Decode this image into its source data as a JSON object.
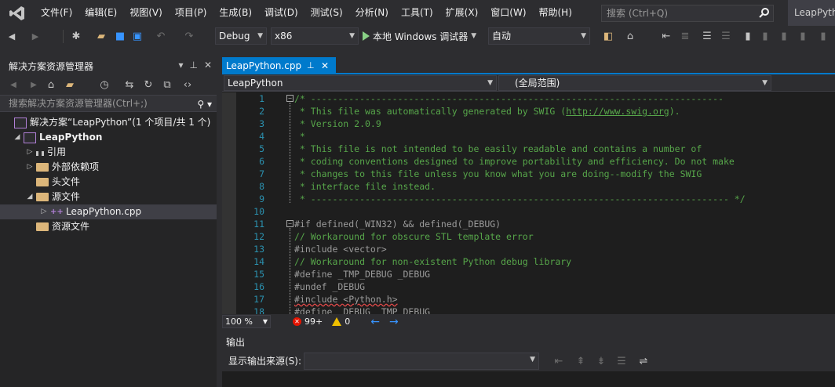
{
  "menu": {
    "items": [
      "文件(F)",
      "编辑(E)",
      "视图(V)",
      "项目(P)",
      "生成(B)",
      "调试(D)",
      "测试(S)",
      "分析(N)",
      "工具(T)",
      "扩展(X)",
      "窗口(W)",
      "帮助(H)"
    ],
    "search_placeholder": "搜索 (Ctrl+Q)",
    "title": "LeapPython"
  },
  "toolbar": {
    "config": "Debug",
    "platform": "x86",
    "run_label": "本地 Windows 调试器",
    "run_mode": "自动"
  },
  "solution_explorer": {
    "title": "解决方案资源管理器",
    "search_placeholder": "搜索解决方案资源管理器(Ctrl+;)",
    "tree": {
      "solution": "解决方案“LeapPython”(1 个项目/共 1 个)",
      "project": "LeapPython",
      "references": "引用",
      "external_deps": "外部依赖项",
      "headers": "头文件",
      "sources": "源文件",
      "source_file": "LeapPython.cpp",
      "resources": "资源文件"
    }
  },
  "editor": {
    "tab_label": "LeapPython.cpp",
    "tab_pin": "ㅁ",
    "tab_close": "✕",
    "nav_project": "LeapPython",
    "nav_scope": "(全局范围)",
    "lines": [
      {
        "n": "1",
        "text": "/* ----------------------------------------------------------------------------"
      },
      {
        "n": "2",
        "text": " * This file was automatically generated by SWIG (",
        "link": "http://www.swig.org",
        "after": ")."
      },
      {
        "n": "3",
        "text": " * Version 2.0.9"
      },
      {
        "n": "4",
        "text": " *"
      },
      {
        "n": "5",
        "text": " * This file is not intended to be easily readable and contains a number of"
      },
      {
        "n": "6",
        "text": " * coding conventions designed to improve portability and efficiency. Do not make"
      },
      {
        "n": "7",
        "text": " * changes to this file unless you know what you are doing--modify the SWIG"
      },
      {
        "n": "8",
        "text": " * interface file instead."
      },
      {
        "n": "9",
        "text": " * ----------------------------------------------------------------------------- */"
      },
      {
        "n": "10",
        "text": ""
      },
      {
        "n": "11",
        "text": "#if defined(_WIN32) && defined(_DEBUG)"
      },
      {
        "n": "12",
        "text": "// Workaround for obscure STL template error"
      },
      {
        "n": "13",
        "text": "#include <vector>"
      },
      {
        "n": "14",
        "text": "// Workaround for non-existent Python debug library"
      },
      {
        "n": "15",
        "text": "#define _TMP_DEBUG _DEBUG"
      },
      {
        "n": "16",
        "text": "#undef _DEBUG"
      },
      {
        "n": "17",
        "text": "#include <Python.h>"
      },
      {
        "n": "18",
        "text": "#define _DEBUG _TMP_DEBUG"
      }
    ],
    "zoom": "100 %",
    "errors": "99+",
    "warnings": "0"
  },
  "output": {
    "title": "输出",
    "source_label": "显示输出来源(S):",
    "source_value": ""
  },
  "colors": {
    "accent": "#007acc",
    "comment": "#57a64a",
    "line_number": "#2b91af",
    "background": "#1e1e1e"
  }
}
